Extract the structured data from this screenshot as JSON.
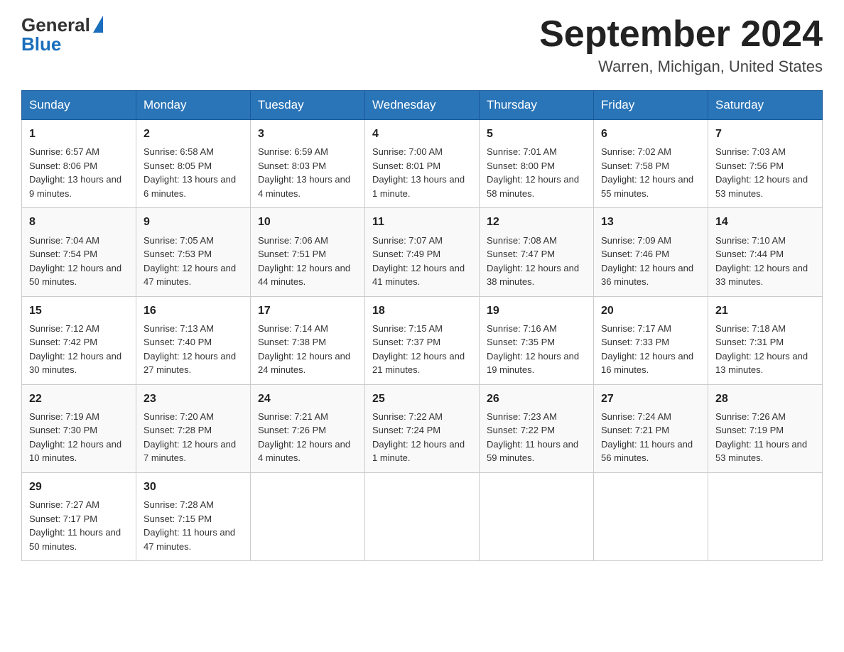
{
  "header": {
    "logo_general": "General",
    "logo_blue": "Blue",
    "title": "September 2024",
    "subtitle": "Warren, Michigan, United States"
  },
  "weekdays": [
    "Sunday",
    "Monday",
    "Tuesday",
    "Wednesday",
    "Thursday",
    "Friday",
    "Saturday"
  ],
  "weeks": [
    [
      {
        "day": "1",
        "sunrise": "6:57 AM",
        "sunset": "8:06 PM",
        "daylight": "13 hours and 9 minutes."
      },
      {
        "day": "2",
        "sunrise": "6:58 AM",
        "sunset": "8:05 PM",
        "daylight": "13 hours and 6 minutes."
      },
      {
        "day": "3",
        "sunrise": "6:59 AM",
        "sunset": "8:03 PM",
        "daylight": "13 hours and 4 minutes."
      },
      {
        "day": "4",
        "sunrise": "7:00 AM",
        "sunset": "8:01 PM",
        "daylight": "13 hours and 1 minute."
      },
      {
        "day": "5",
        "sunrise": "7:01 AM",
        "sunset": "8:00 PM",
        "daylight": "12 hours and 58 minutes."
      },
      {
        "day": "6",
        "sunrise": "7:02 AM",
        "sunset": "7:58 PM",
        "daylight": "12 hours and 55 minutes."
      },
      {
        "day": "7",
        "sunrise": "7:03 AM",
        "sunset": "7:56 PM",
        "daylight": "12 hours and 53 minutes."
      }
    ],
    [
      {
        "day": "8",
        "sunrise": "7:04 AM",
        "sunset": "7:54 PM",
        "daylight": "12 hours and 50 minutes."
      },
      {
        "day": "9",
        "sunrise": "7:05 AM",
        "sunset": "7:53 PM",
        "daylight": "12 hours and 47 minutes."
      },
      {
        "day": "10",
        "sunrise": "7:06 AM",
        "sunset": "7:51 PM",
        "daylight": "12 hours and 44 minutes."
      },
      {
        "day": "11",
        "sunrise": "7:07 AM",
        "sunset": "7:49 PM",
        "daylight": "12 hours and 41 minutes."
      },
      {
        "day": "12",
        "sunrise": "7:08 AM",
        "sunset": "7:47 PM",
        "daylight": "12 hours and 38 minutes."
      },
      {
        "day": "13",
        "sunrise": "7:09 AM",
        "sunset": "7:46 PM",
        "daylight": "12 hours and 36 minutes."
      },
      {
        "day": "14",
        "sunrise": "7:10 AM",
        "sunset": "7:44 PM",
        "daylight": "12 hours and 33 minutes."
      }
    ],
    [
      {
        "day": "15",
        "sunrise": "7:12 AM",
        "sunset": "7:42 PM",
        "daylight": "12 hours and 30 minutes."
      },
      {
        "day": "16",
        "sunrise": "7:13 AM",
        "sunset": "7:40 PM",
        "daylight": "12 hours and 27 minutes."
      },
      {
        "day": "17",
        "sunrise": "7:14 AM",
        "sunset": "7:38 PM",
        "daylight": "12 hours and 24 minutes."
      },
      {
        "day": "18",
        "sunrise": "7:15 AM",
        "sunset": "7:37 PM",
        "daylight": "12 hours and 21 minutes."
      },
      {
        "day": "19",
        "sunrise": "7:16 AM",
        "sunset": "7:35 PM",
        "daylight": "12 hours and 19 minutes."
      },
      {
        "day": "20",
        "sunrise": "7:17 AM",
        "sunset": "7:33 PM",
        "daylight": "12 hours and 16 minutes."
      },
      {
        "day": "21",
        "sunrise": "7:18 AM",
        "sunset": "7:31 PM",
        "daylight": "12 hours and 13 minutes."
      }
    ],
    [
      {
        "day": "22",
        "sunrise": "7:19 AM",
        "sunset": "7:30 PM",
        "daylight": "12 hours and 10 minutes."
      },
      {
        "day": "23",
        "sunrise": "7:20 AM",
        "sunset": "7:28 PM",
        "daylight": "12 hours and 7 minutes."
      },
      {
        "day": "24",
        "sunrise": "7:21 AM",
        "sunset": "7:26 PM",
        "daylight": "12 hours and 4 minutes."
      },
      {
        "day": "25",
        "sunrise": "7:22 AM",
        "sunset": "7:24 PM",
        "daylight": "12 hours and 1 minute."
      },
      {
        "day": "26",
        "sunrise": "7:23 AM",
        "sunset": "7:22 PM",
        "daylight": "11 hours and 59 minutes."
      },
      {
        "day": "27",
        "sunrise": "7:24 AM",
        "sunset": "7:21 PM",
        "daylight": "11 hours and 56 minutes."
      },
      {
        "day": "28",
        "sunrise": "7:26 AM",
        "sunset": "7:19 PM",
        "daylight": "11 hours and 53 minutes."
      }
    ],
    [
      {
        "day": "29",
        "sunrise": "7:27 AM",
        "sunset": "7:17 PM",
        "daylight": "11 hours and 50 minutes."
      },
      {
        "day": "30",
        "sunrise": "7:28 AM",
        "sunset": "7:15 PM",
        "daylight": "11 hours and 47 minutes."
      },
      null,
      null,
      null,
      null,
      null
    ]
  ]
}
